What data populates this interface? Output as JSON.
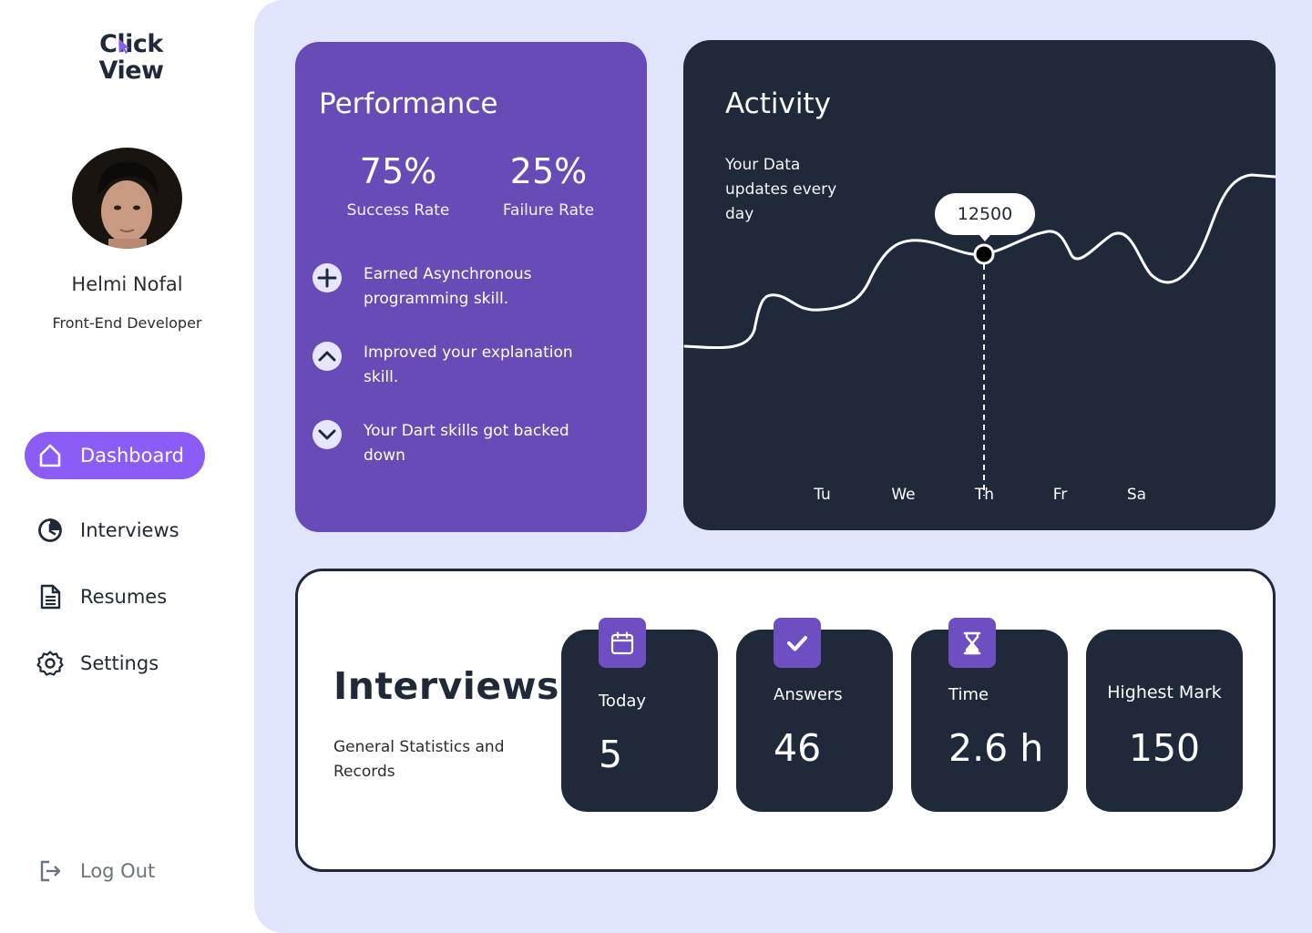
{
  "brand": {
    "logo_line1": "Click",
    "logo_line2": "View"
  },
  "user": {
    "name": "Helmi Nofal",
    "role": "Front-End Developer"
  },
  "nav": {
    "items": [
      {
        "label": "Dashboard",
        "icon": "home-icon",
        "active": true
      },
      {
        "label": "Interviews",
        "icon": "clock-icon",
        "active": false
      },
      {
        "label": "Resumes",
        "icon": "document-icon",
        "active": false
      },
      {
        "label": "Settings",
        "icon": "gear-icon",
        "active": false
      }
    ],
    "logout": {
      "label": "Log Out",
      "icon": "logout-icon"
    }
  },
  "performance": {
    "title": "Performance",
    "stats": [
      {
        "value": "75%",
        "label": "Success Rate"
      },
      {
        "value": "25%",
        "label": "Failure Rate"
      }
    ],
    "items": [
      {
        "icon": "plus-circle-icon",
        "text": "Earned Asynchronous programming skill."
      },
      {
        "icon": "chevron-up-circle-icon",
        "text": "Improved your explanation skill."
      },
      {
        "icon": "chevron-down-circle-icon",
        "text": "Your  Dart skills got backed down"
      }
    ]
  },
  "activity": {
    "title": "Activity",
    "subtitle": "Your Data updates every day",
    "tooltip_value": "12500",
    "days": [
      "Tu",
      "We",
      "Th",
      "Fr",
      "Sa"
    ]
  },
  "interviews": {
    "title": "Interviews",
    "subtitle": "General Statistics and Records",
    "tiles": [
      {
        "label": "Today",
        "value": "5",
        "icon": "calendar-icon"
      },
      {
        "label": "Answers",
        "value": "46",
        "icon": "checkmark-icon"
      },
      {
        "label": "Time",
        "value": "2.6 h",
        "icon": "hourglass-icon"
      },
      {
        "label": "Highest Mark",
        "value": "150"
      }
    ]
  },
  "colors": {
    "accent": "#8b5cf6",
    "performance_bg": "#674cb7",
    "dark_card": "#20293a",
    "main_bg": "#e0e4fd"
  }
}
